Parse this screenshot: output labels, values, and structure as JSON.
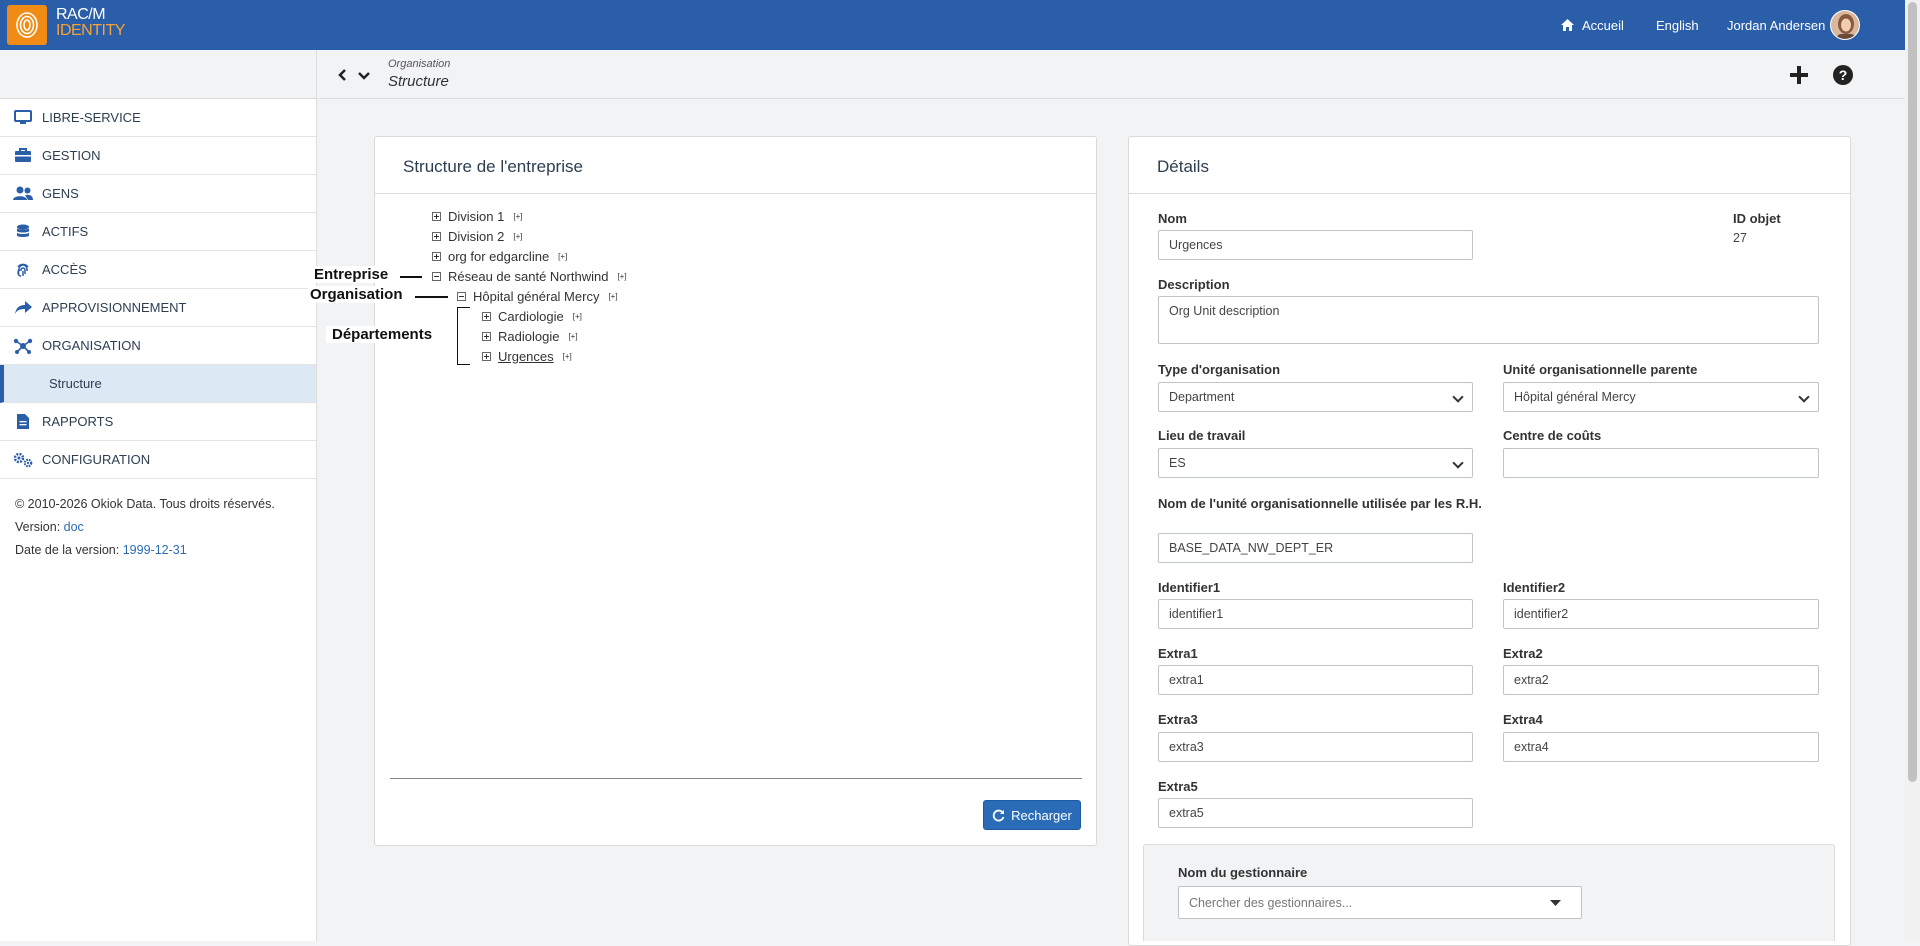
{
  "header": {
    "brand_line1": "RAC/M",
    "brand_line2": "IDENTITY",
    "home_label": "Accueil",
    "language_label": "English",
    "user_name": "Jordan Andersen"
  },
  "breadcrumb": {
    "parent": "Organisation",
    "current": "Structure"
  },
  "sidebar": {
    "items": [
      {
        "label": "LIBRE-SERVICE",
        "icon": "monitor-icon"
      },
      {
        "label": "GESTION",
        "icon": "toolbox-icon"
      },
      {
        "label": "GENS",
        "icon": "users-icon"
      },
      {
        "label": "ACTIFS",
        "icon": "database-icon"
      },
      {
        "label": "ACCÈS",
        "icon": "fingerprint-icon"
      },
      {
        "label": "APPROVISIONNEMENT",
        "icon": "share-icon"
      },
      {
        "label": "ORGANISATION",
        "icon": "network-icon"
      },
      {
        "label": "RAPPORTS",
        "icon": "file-icon"
      },
      {
        "label": "CONFIGURATION",
        "icon": "gears-icon"
      }
    ],
    "sub_item": "Structure",
    "footer": {
      "copyright": "© 2010-2026 Okiok Data. Tous droits réservés.",
      "version_label": "Version:",
      "version_value": "doc",
      "date_label": "Date de la version:",
      "date_value": "1999-12-31"
    }
  },
  "tree_card": {
    "title": "Structure de l'entreprise",
    "plus_marker": "[+]",
    "nodes": [
      {
        "label": "Division 1"
      },
      {
        "label": "Division 2"
      },
      {
        "label": "org for edgarcline"
      },
      {
        "label": "Réseau de santé Northwind"
      },
      {
        "label": "Hôpital général Mercy"
      },
      {
        "label": "Cardiologie"
      },
      {
        "label": "Radiologie"
      },
      {
        "label": "Urgences"
      }
    ],
    "annotations": {
      "entreprise": "Entreprise",
      "organisation": "Organisation",
      "departements": "Départements"
    },
    "reload_button": "Recharger"
  },
  "details_card": {
    "title": "Détails",
    "fields": {
      "nom": {
        "label": "Nom",
        "value": "Urgences"
      },
      "id_objet": {
        "label": "ID objet",
        "value": "27"
      },
      "description": {
        "label": "Description",
        "value": "Org Unit description"
      },
      "type_org": {
        "label": "Type d'organisation",
        "value": "Department"
      },
      "parent": {
        "label": "Unité organisationnelle parente",
        "value": "Hôpital général Mercy"
      },
      "lieu": {
        "label": "Lieu de travail",
        "value": "ES"
      },
      "centre": {
        "label": "Centre de coûts",
        "value": ""
      },
      "rh_name": {
        "label": "Nom de l'unité organisationnelle utilisée par les R.H.",
        "value": "BASE_DATA_NW_DEPT_ER"
      },
      "identifier1": {
        "label": "Identifier1",
        "value": "identifier1"
      },
      "identifier2": {
        "label": "Identifier2",
        "value": "identifier2"
      },
      "extra1": {
        "label": "Extra1",
        "value": "extra1"
      },
      "extra2": {
        "label": "Extra2",
        "value": "extra2"
      },
      "extra3": {
        "label": "Extra3",
        "value": "extra3"
      },
      "extra4": {
        "label": "Extra4",
        "value": "extra4"
      },
      "extra5": {
        "label": "Extra5",
        "value": "extra5"
      }
    },
    "manager": {
      "label": "Nom du gestionnaire",
      "placeholder": "Chercher des gestionnaires..."
    }
  },
  "colors": {
    "header_bg": "#2a5ea9",
    "logo_orange": "#f08c16",
    "button_blue": "#2a6cb8",
    "sidebar_active_bg": "#dde8f5"
  }
}
